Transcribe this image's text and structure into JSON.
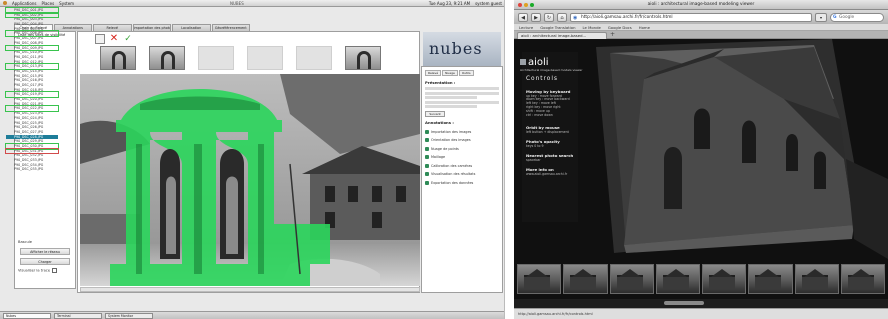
{
  "left_app": {
    "panel_title": "nubes",
    "top_bar": {
      "menus": [
        "Applications",
        "Places",
        "System"
      ],
      "datetime": "Tue Aug 23, 9:21 AM",
      "user": "system guest",
      "window_title": "NUBES"
    },
    "tabs": [
      "Choix du Relevé",
      "Annotations",
      "Relevé",
      "Importation des photos",
      "Localisation",
      "Géoréférencement"
    ],
    "file_list_header": "Liste des sites de visibilité",
    "files": [
      {
        "name": "P90_DSC_001.JPG",
        "state": "green"
      },
      {
        "name": "P90_DSC_002.JPG",
        "state": "green"
      },
      {
        "name": "P90_DSC_003.JPG",
        "state": ""
      },
      {
        "name": "P90_DSC_004.JPG",
        "state": ""
      },
      {
        "name": "P90_DSC_005.JPG",
        "state": ""
      },
      {
        "name": "P90_DSC_006.JPG",
        "state": "green"
      },
      {
        "name": "P90_DSC_007.JPG",
        "state": ""
      },
      {
        "name": "P90_DSC_008.JPG",
        "state": ""
      },
      {
        "name": "P90_DSC_009.JPG",
        "state": "green"
      },
      {
        "name": "P90_DSC_010.JPG",
        "state": ""
      },
      {
        "name": "P90_DSC_011.JPG",
        "state": ""
      },
      {
        "name": "P90_DSC_012.JPG",
        "state": ""
      },
      {
        "name": "P90_DSC_013.JPG",
        "state": "green"
      },
      {
        "name": "P90_DSC_014.JPG",
        "state": ""
      },
      {
        "name": "P90_DSC_015.JPG",
        "state": ""
      },
      {
        "name": "P90_DSC_016.JPG",
        "state": ""
      },
      {
        "name": "P90_DSC_017.JPG",
        "state": ""
      },
      {
        "name": "P90_DSC_018.JPG",
        "state": ""
      },
      {
        "name": "P90_DSC_019.JPG",
        "state": "green"
      },
      {
        "name": "P90_DSC_020.JPG",
        "state": ""
      },
      {
        "name": "P90_DSC_021.JPG",
        "state": ""
      },
      {
        "name": "P90_DSC_022.JPG",
        "state": "green"
      },
      {
        "name": "P90_DSC_023.JPG",
        "state": ""
      },
      {
        "name": "P90_DSC_024.JPG",
        "state": ""
      },
      {
        "name": "P90_DSC_025.JPG",
        "state": ""
      },
      {
        "name": "P90_DSC_026.JPG",
        "state": ""
      },
      {
        "name": "P90_DSC_027.JPG",
        "state": ""
      },
      {
        "name": "P90_DSC_028.JPG",
        "state": "selected"
      },
      {
        "name": "P90_DSC_029.JPG",
        "state": ""
      },
      {
        "name": "P90_DSC_030.JPG",
        "state": "green"
      },
      {
        "name": "P90_DSC_031.JPG",
        "state": "red"
      },
      {
        "name": "P90_DSC_032.JPG",
        "state": ""
      },
      {
        "name": "P90_DSC_033.JPG",
        "state": ""
      },
      {
        "name": "P90_DSC_034.JPG",
        "state": ""
      },
      {
        "name": "P90_DSC_035.JPG",
        "state": ""
      }
    ],
    "left_controls": {
      "label": "Bascule",
      "button1": "Afficher le réseau",
      "button2": "Charger",
      "visible_label": "Visualiser la trace"
    },
    "right_panel": {
      "tabs": [
        "Relevé",
        "Nuage",
        "Outils"
      ],
      "heading1": "Présentation :",
      "button": "Suivant",
      "heading2": "Annotations :",
      "items": [
        "Importation des images",
        "Orientation des images",
        "Nuage de points",
        "Maillage",
        "Calibration des caméras",
        "Visualisation des résultats",
        "Exportation des données"
      ]
    },
    "taskbar": [
      "Nubes",
      "Terminal",
      "System Monitor"
    ]
  },
  "right_app": {
    "window_title": "aioli : architectural image-based modeling viewer",
    "url": "http://aioli.gamsau.archi.fr/fr/controls.html",
    "search_placeholder": "Google",
    "bookmarks": [
      "Lecture",
      "Google Translation",
      "Le Monde",
      "Google Docs",
      "Home"
    ],
    "tab_title": "aioli : architectural image-based...",
    "logo": "aioli",
    "logo_subtitle": "Architectural image-based models viewer",
    "controls_title": "Controls",
    "blocks": [
      {
        "heading": "Moving by keyboard",
        "lines": [
          "up key : move forward",
          "down key : move backward",
          "left key : move left",
          "right key : move right",
          "shift : move up",
          "ctrl : move down"
        ]
      },
      {
        "heading": "Orbit by mouse",
        "lines": [
          "left button + displacement"
        ]
      },
      {
        "heading": "Photo's opacity",
        "lines": [
          "keys 0 to 9"
        ]
      },
      {
        "heading": "Nearest photo search",
        "lines": [
          "spacebar"
        ]
      },
      {
        "heading": "More info on",
        "lines": [
          "www.aioli.gamsau.archi.fr"
        ]
      }
    ],
    "status_url": "http://aioli.gamsau.archi.fr/fr/controls.html"
  },
  "colors": {
    "selection_green": "#2bd65c",
    "list_selected": "#1e7d99",
    "error_red": "#d24b4b",
    "viewer_bg": "#101010"
  }
}
